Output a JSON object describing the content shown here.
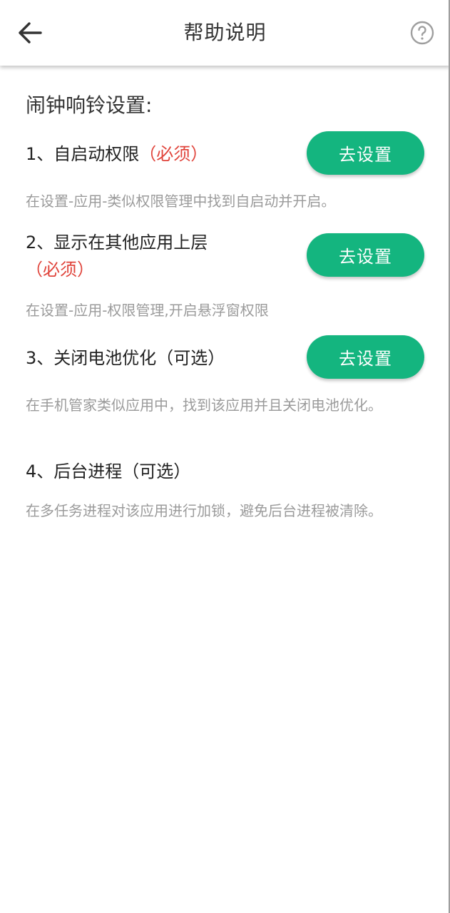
{
  "header": {
    "title": "帮助说明",
    "back_icon": "arrow-left-icon",
    "help_icon": "question-circle-icon"
  },
  "colors": {
    "accent": "#14b57f",
    "required": "#e0443b",
    "title_text": "#333333",
    "desc_text": "#9b9b9b"
  },
  "main": {
    "section_title": "闹钟响铃设置:",
    "items": [
      {
        "title": "1、自启动权限",
        "tag": "（必须）",
        "description": "在设置-应用-类似权限管理中找到自启动并开启。",
        "button_label": "去设置"
      },
      {
        "title": "2、显示在其他应用上层",
        "tag": "（必须）",
        "description": "在设置-应用-权限管理,开启悬浮窗权限",
        "button_label": "去设置"
      },
      {
        "title": "3、关闭电池优化（可选）",
        "tag": "",
        "description": "在手机管家类似应用中，找到该应用并且关闭电池优化。",
        "button_label": "去设置"
      },
      {
        "title": "4、后台进程（可选）",
        "tag": "",
        "description": "在多任务进程对该应用进行加锁，避免后台进程被清除。"
      }
    ]
  }
}
